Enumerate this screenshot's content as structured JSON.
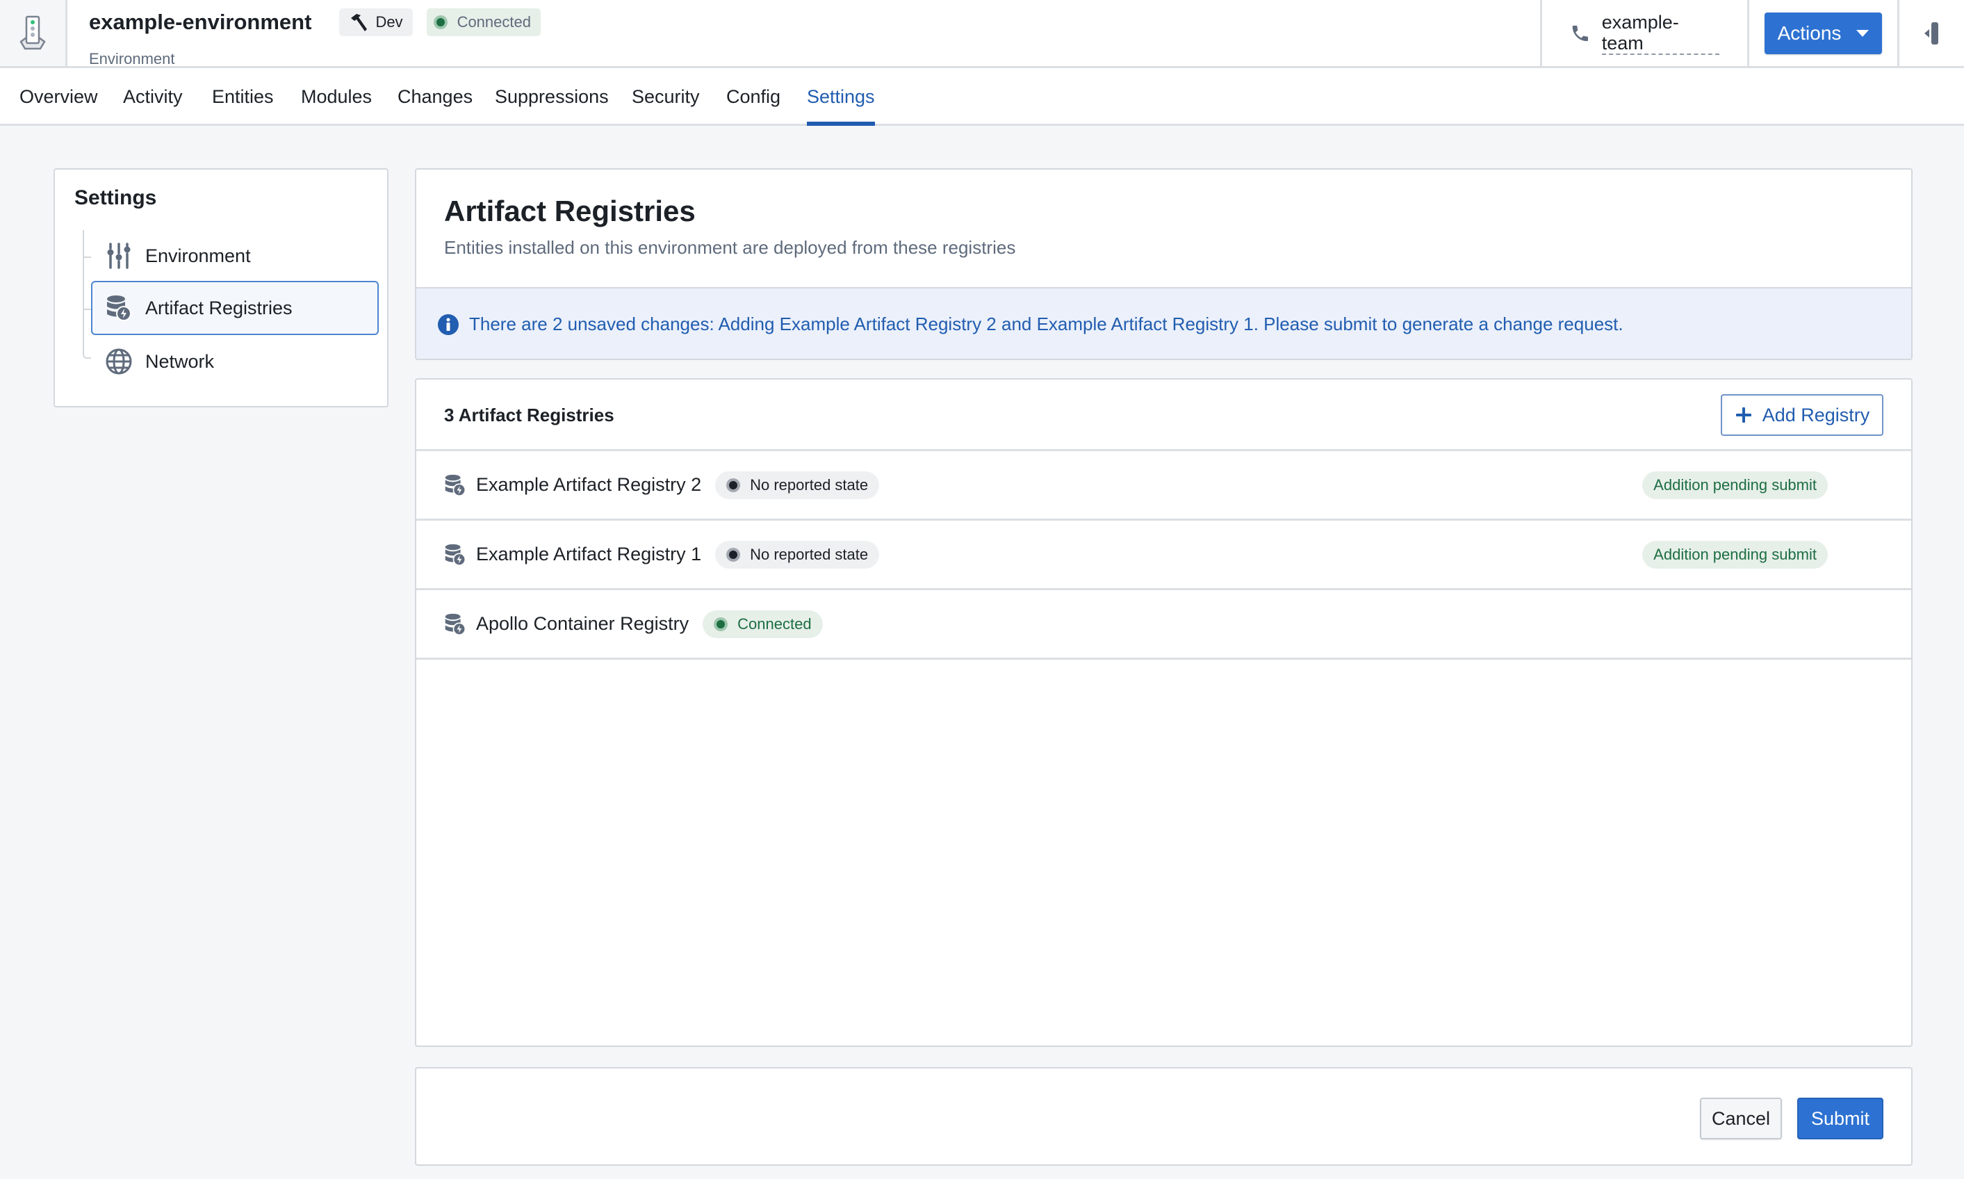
{
  "header": {
    "title": "example-environment",
    "subtitle": "Environment",
    "dev_badge": "Dev",
    "status_badge": "Connected",
    "team": "example-team",
    "actions_label": "Actions"
  },
  "nav": {
    "tabs": [
      {
        "label": "Overview"
      },
      {
        "label": "Activity"
      },
      {
        "label": "Entities"
      },
      {
        "label": "Modules"
      },
      {
        "label": "Changes"
      },
      {
        "label": "Suppressions"
      },
      {
        "label": "Security"
      },
      {
        "label": "Config"
      },
      {
        "label": "Settings",
        "active": true
      }
    ]
  },
  "sidebar": {
    "title": "Settings",
    "items": [
      {
        "label": "Environment",
        "icon": "sliders-icon"
      },
      {
        "label": "Artifact Registries",
        "icon": "database-lightning-icon",
        "active": true
      },
      {
        "label": "Network",
        "icon": "globe-icon"
      }
    ]
  },
  "main": {
    "title": "Artifact Registries",
    "subtitle": "Entities installed on this environment are deployed from these registries",
    "banner": "There are 2 unsaved changes: Adding Example Artifact Registry 2 and Example Artifact Registry 1. Please submit to generate a change request.",
    "list": {
      "count_label": "3 Artifact Registries",
      "add_label": "Add Registry",
      "rows": [
        {
          "name": "Example Artifact Registry 2",
          "state": "No reported state",
          "pending": "Addition pending submit"
        },
        {
          "name": "Example Artifact Registry 1",
          "state": "No reported state",
          "pending": "Addition pending submit"
        },
        {
          "name": "Apollo Container Registry",
          "state": "Connected",
          "pending": null
        }
      ]
    },
    "footer": {
      "cancel_label": "Cancel",
      "submit_label": "Submit"
    }
  },
  "colors": {
    "primary": "#2d72d2",
    "link_blue": "#215db0",
    "success_green": "#1c6e42",
    "banner_bg": "#ebf0fa"
  }
}
